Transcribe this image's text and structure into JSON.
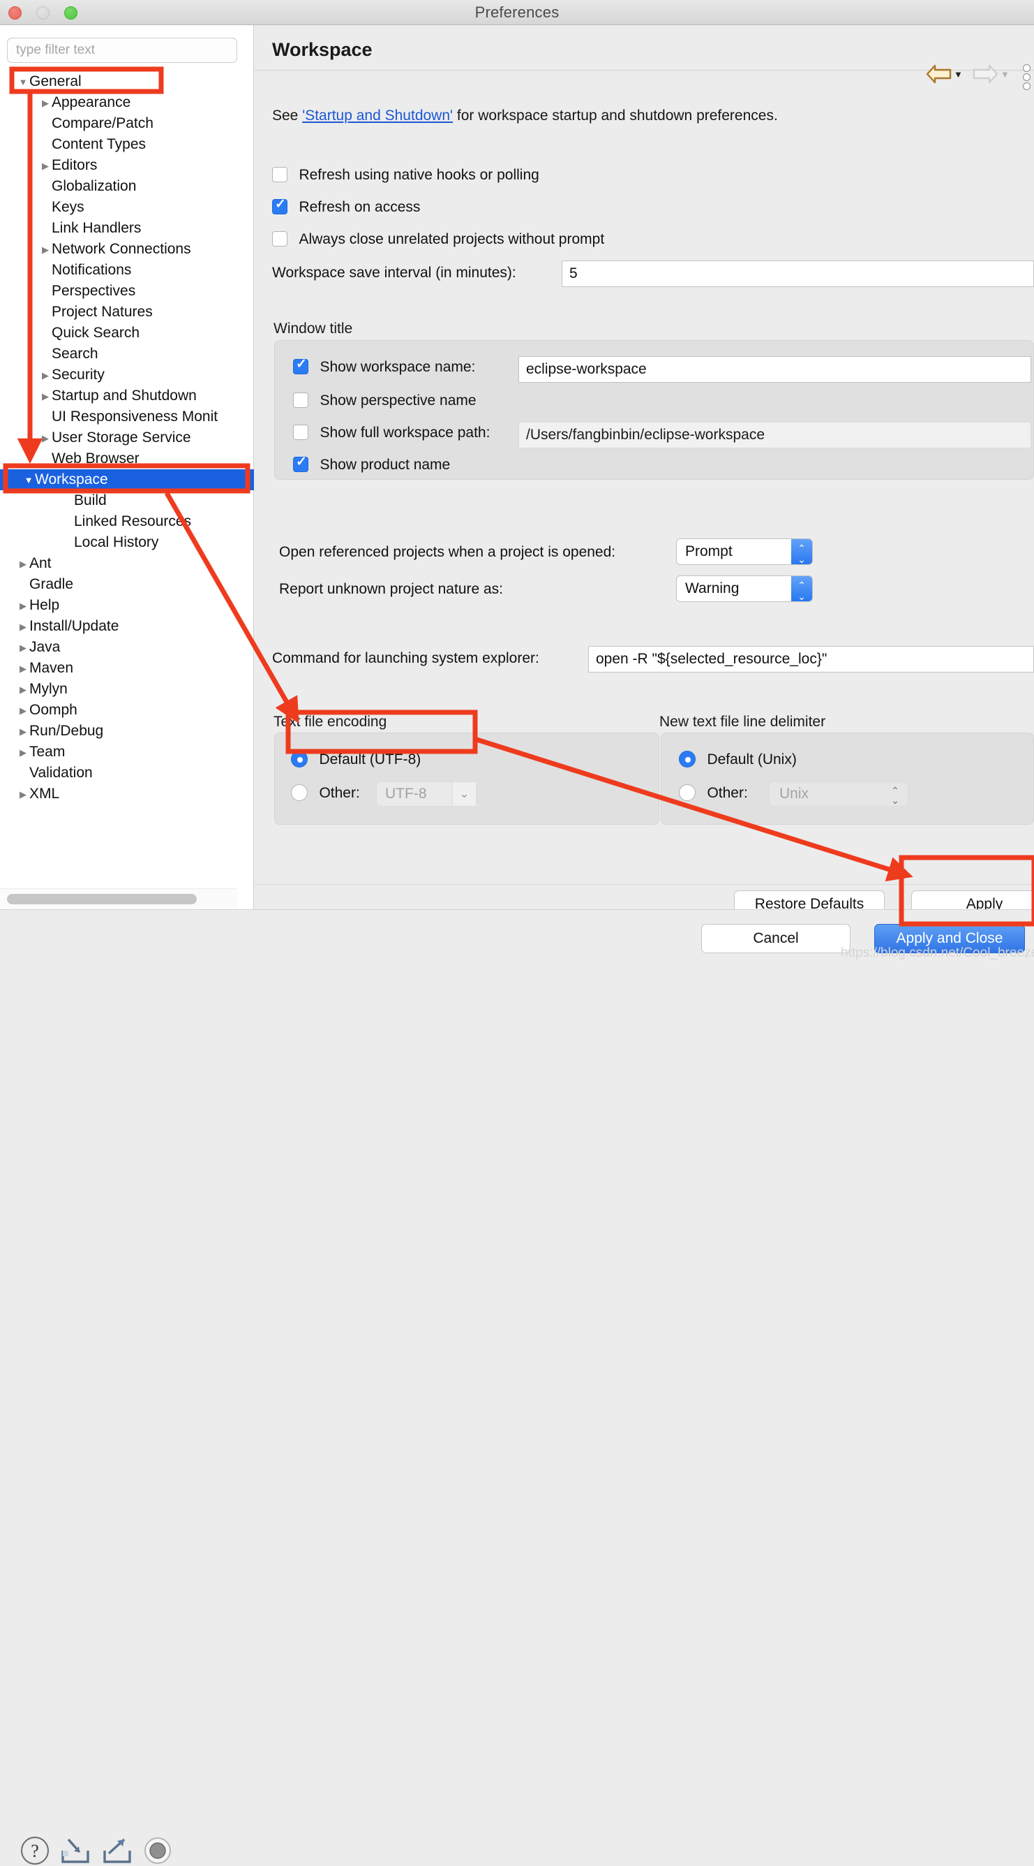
{
  "window": {
    "title": "Preferences"
  },
  "sidebar": {
    "filter_placeholder": "type filter text",
    "tree": [
      {
        "label": "General",
        "indent": 0,
        "arrow": "down",
        "selected": false,
        "boxed": true
      },
      {
        "label": "Appearance",
        "indent": 1,
        "arrow": "right",
        "selected": false
      },
      {
        "label": "Compare/Patch",
        "indent": 1,
        "arrow": "none",
        "selected": false
      },
      {
        "label": "Content Types",
        "indent": 1,
        "arrow": "none",
        "selected": false
      },
      {
        "label": "Editors",
        "indent": 1,
        "arrow": "right",
        "selected": false
      },
      {
        "label": "Globalization",
        "indent": 1,
        "arrow": "none",
        "selected": false
      },
      {
        "label": "Keys",
        "indent": 1,
        "arrow": "none",
        "selected": false
      },
      {
        "label": "Link Handlers",
        "indent": 1,
        "arrow": "none",
        "selected": false
      },
      {
        "label": "Network Connections",
        "indent": 1,
        "arrow": "right",
        "selected": false
      },
      {
        "label": "Notifications",
        "indent": 1,
        "arrow": "none",
        "selected": false
      },
      {
        "label": "Perspectives",
        "indent": 1,
        "arrow": "none",
        "selected": false
      },
      {
        "label": "Project Natures",
        "indent": 1,
        "arrow": "none",
        "selected": false
      },
      {
        "label": "Quick Search",
        "indent": 1,
        "arrow": "none",
        "selected": false
      },
      {
        "label": "Search",
        "indent": 1,
        "arrow": "none",
        "selected": false
      },
      {
        "label": "Security",
        "indent": 1,
        "arrow": "right",
        "selected": false
      },
      {
        "label": "Startup and Shutdown",
        "indent": 1,
        "arrow": "right",
        "selected": false
      },
      {
        "label": "UI Responsiveness Monit",
        "indent": 1,
        "arrow": "none",
        "selected": false
      },
      {
        "label": "User Storage Service",
        "indent": 1,
        "arrow": "right",
        "selected": false
      },
      {
        "label": "Web Browser",
        "indent": 1,
        "arrow": "none",
        "selected": false
      },
      {
        "label": "Workspace",
        "indent": 1,
        "arrow": "down",
        "selected": true,
        "boxed": true
      },
      {
        "label": "Build",
        "indent": 2,
        "arrow": "none",
        "selected": false
      },
      {
        "label": "Linked Resources",
        "indent": 2,
        "arrow": "none",
        "selected": false
      },
      {
        "label": "Local History",
        "indent": 2,
        "arrow": "none",
        "selected": false
      },
      {
        "label": "Ant",
        "indent": 0,
        "arrow": "right",
        "selected": false
      },
      {
        "label": "Gradle",
        "indent": 0,
        "arrow": "none",
        "selected": false
      },
      {
        "label": "Help",
        "indent": 0,
        "arrow": "right",
        "selected": false
      },
      {
        "label": "Install/Update",
        "indent": 0,
        "arrow": "right",
        "selected": false
      },
      {
        "label": "Java",
        "indent": 0,
        "arrow": "right",
        "selected": false
      },
      {
        "label": "Maven",
        "indent": 0,
        "arrow": "right",
        "selected": false
      },
      {
        "label": "Mylyn",
        "indent": 0,
        "arrow": "right",
        "selected": false
      },
      {
        "label": "Oomph",
        "indent": 0,
        "arrow": "right",
        "selected": false
      },
      {
        "label": "Run/Debug",
        "indent": 0,
        "arrow": "right",
        "selected": false
      },
      {
        "label": "Team",
        "indent": 0,
        "arrow": "right",
        "selected": false
      },
      {
        "label": "Validation",
        "indent": 0,
        "arrow": "none",
        "selected": false
      },
      {
        "label": "XML",
        "indent": 0,
        "arrow": "right",
        "selected": false
      }
    ]
  },
  "pane": {
    "title": "Workspace",
    "toolbar": {
      "back_icon": "back-arrow-icon",
      "forward_icon": "forward-arrow-icon",
      "menu_icon": "vertical-dots-menu-icon"
    },
    "see_prefix": "See ",
    "see_link": "'Startup and Shutdown'",
    "see_suffix": " for workspace startup and shutdown preferences.",
    "checkboxes": [
      {
        "label": "Refresh using native hooks or polling",
        "checked": false
      },
      {
        "label": "Refresh on access",
        "checked": true
      },
      {
        "label": "Always close unrelated projects without prompt",
        "checked": false
      }
    ],
    "save_interval": {
      "label": "Workspace save interval (in minutes):",
      "value": "5"
    },
    "window_title_group": {
      "title": "Window title",
      "show_workspace_name": {
        "label": "Show workspace name:",
        "checked": true,
        "value": "eclipse-workspace"
      },
      "show_perspective_name": {
        "label": "Show perspective name",
        "checked": false
      },
      "show_full_workspace_path": {
        "label": "Show full workspace path:",
        "checked": false,
        "value": "/Users/fangbinbin/eclipse-workspace"
      },
      "show_product_name": {
        "label": "Show product name",
        "checked": true
      }
    },
    "open_referenced": {
      "label": "Open referenced projects when a project is opened:",
      "value": "Prompt"
    },
    "report_nature": {
      "label": "Report unknown project nature as:",
      "value": "Warning"
    },
    "explorer_command": {
      "label": "Command for launching system explorer:",
      "value": "open -R \"${selected_resource_loc}\""
    },
    "encoding_group": {
      "title": "Text file encoding",
      "default_label": "Default (UTF-8)",
      "default_selected": true,
      "other_label": "Other:",
      "other_value": "UTF-8",
      "other_enabled": false
    },
    "delimiter_group": {
      "title": "New text file line delimiter",
      "default_label": "Default (Unix)",
      "default_selected": true,
      "other_label": "Other:",
      "other_value": "Unix",
      "other_enabled": false
    },
    "restore_defaults_label": "Restore Defaults",
    "apply_label": "Apply"
  },
  "footer": {
    "help_icon": "help-question-icon",
    "import_icon": "import-icon",
    "export_icon": "export-icon",
    "record_icon": "record-circle-icon",
    "cancel_label": "Cancel",
    "apply_close_label": "Apply and Close"
  },
  "annotations": {
    "color": "#ee3b1e",
    "watermark": "https://blog.csdn.net/Cool_breeze_bin"
  },
  "colors": {
    "accent_blue": "#1a61e0",
    "checkbox_blue": "#2b7bf3",
    "primary_button": "#2f74e8",
    "link_blue": "#1b57d4",
    "annotation_red": "#ee3b1e"
  }
}
